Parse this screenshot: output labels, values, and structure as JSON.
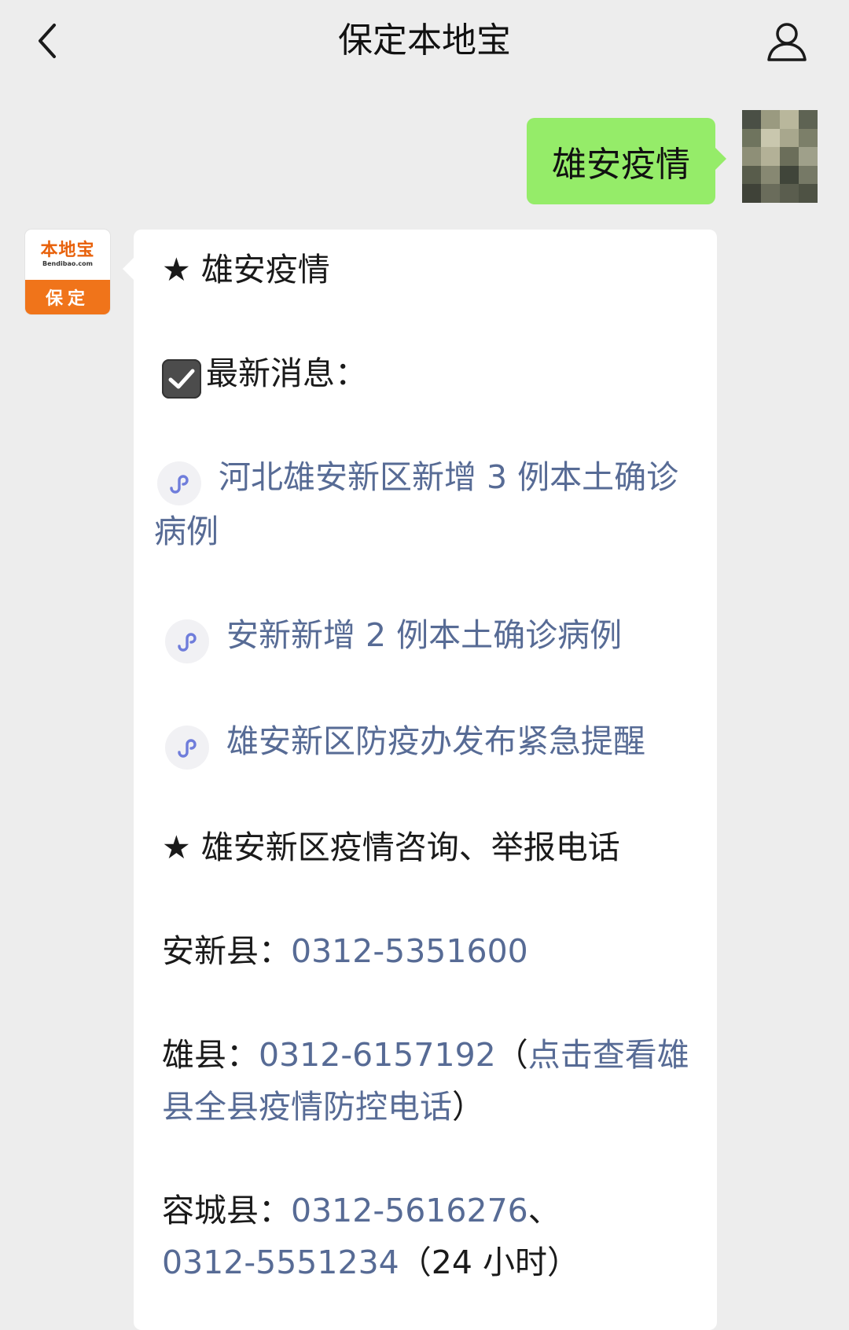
{
  "nav": {
    "title": "保定本地宝",
    "back_icon": "chevron-left-icon",
    "profile_icon": "person-icon"
  },
  "messages": {
    "outgoing": {
      "text": "雄安疫情"
    },
    "incoming": {
      "avatar": {
        "logo_text": "本地宝",
        "logo_sub": "Bendibao.com",
        "city": "保定"
      },
      "heading_star": "★",
      "heading": "雄安疫情",
      "latest_label": "最新消息：",
      "links": [
        {
          "text": "河北雄安新区新增 3 例本土确诊病例"
        },
        {
          "text": "安新新增 2 例本土确诊病例"
        },
        {
          "text": "雄安新区防疫办发布紧急提醒"
        }
      ],
      "hotline_heading": "雄安新区疫情咨询、举报电话",
      "anxin": {
        "label": "安新县：",
        "phone": "0312-5351600"
      },
      "xiongxian": {
        "label": "雄县：",
        "phone": "0312-6157192",
        "paren_open": "（",
        "more_link": "点击查看雄县全县疫情防控电话",
        "paren_close": "）"
      },
      "rongcheng": {
        "label": "容城县：",
        "phone1": "0312-5616276",
        "sep": "、",
        "phone2": "0312-5551234",
        "note": "（24 小时）"
      }
    }
  },
  "colors": {
    "background": "#ededed",
    "bubble_out": "#95ec69",
    "bubble_in": "#ffffff",
    "link": "#576b95",
    "logo_orange": "#f0741a"
  }
}
